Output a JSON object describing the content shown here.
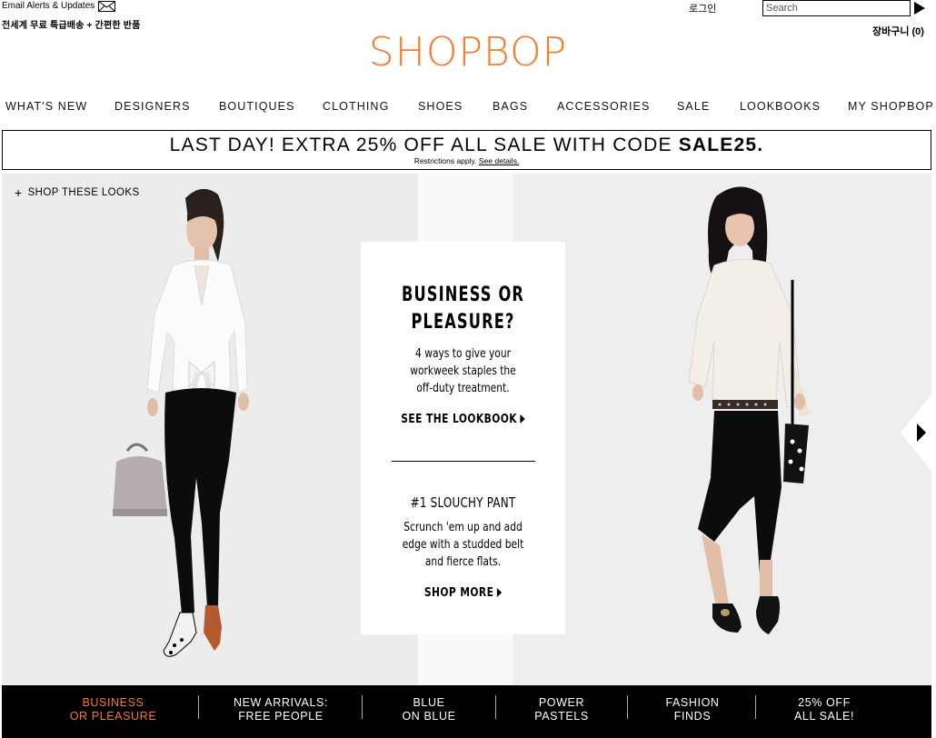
{
  "util": {
    "email_alerts": "Email Alerts & Updates",
    "shipping_notice": "전세계 무료 특급배송 + 간편한 반품",
    "login": "로그인",
    "search_placeholder": "Search",
    "cart_label": "장바구니",
    "cart_count": "(0)"
  },
  "logo": "SHOPBOP",
  "brand_color": "#f47c2c",
  "nav": [
    {
      "label": "WHAT'S NEW"
    },
    {
      "label": "DESIGNERS"
    },
    {
      "label": "BOUTIQUES"
    },
    {
      "label": "CLOTHING"
    },
    {
      "label": "SHOES"
    },
    {
      "label": "BAGS"
    },
    {
      "label": "ACCESSORIES"
    },
    {
      "label": "SALE"
    },
    {
      "label": "LOOKBOOKS"
    },
    {
      "label": "MY SHOPBOP"
    }
  ],
  "promo": {
    "headline_prefix": "LAST DAY! EXTRA 25% OFF ALL SALE WITH CODE ",
    "code": "SALE25.",
    "restrictions": "Restrictions apply.",
    "details_link": "See details."
  },
  "hero": {
    "shop_looks": "SHOP THESE LOOKS",
    "card": {
      "title_line1": "BUSINESS OR",
      "title_line2": "PLEASURE?",
      "desc_line1": "4 ways to give your",
      "desc_line2": "workweek staples the",
      "desc_line3": "off-duty treatment.",
      "cta1": "SEE THE LOOKBOOK",
      "subtitle": "#1 SLOUCHY PANT",
      "desc2_line1": "Scrunch 'em up and add",
      "desc2_line2": "edge with a studded belt",
      "desc2_line3": "and fierce flats.",
      "cta2": "SHOP MORE"
    }
  },
  "tabs": [
    {
      "line1": "BUSINESS",
      "line2": "OR PLEASURE",
      "active": true
    },
    {
      "line1": "NEW ARRIVALS:",
      "line2": "FREE PEOPLE",
      "active": false
    },
    {
      "line1": "BLUE",
      "line2": "ON BLUE",
      "active": false
    },
    {
      "line1": "POWER",
      "line2": "PASTELS",
      "active": false
    },
    {
      "line1": "FASHION",
      "line2": "FINDS",
      "active": false
    },
    {
      "line1": "25% OFF",
      "line2": "ALL SALE!",
      "active": false
    }
  ]
}
